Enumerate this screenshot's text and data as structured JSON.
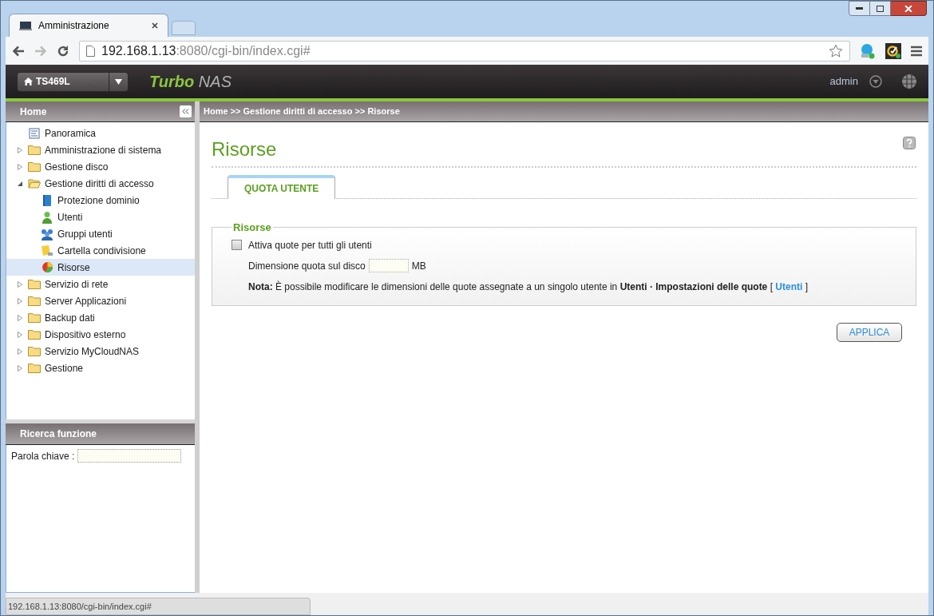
{
  "browser": {
    "tabs": [
      {
        "title": "Amministrazione",
        "selected": true
      }
    ],
    "address": {
      "host": "192.168.1.13",
      "rest": ":8080/cgi-bin/index.cgi#"
    }
  },
  "nas_header": {
    "device": "TS469L",
    "brand_bold": "Turbo",
    "brand_light": "NAS",
    "user": "admin"
  },
  "sidebar": {
    "title": "Home",
    "tree": [
      {
        "label": "Panoramica",
        "kind": "page",
        "selected": false
      },
      {
        "label": "Amministrazione di sistema",
        "kind": "folder",
        "expanded": false,
        "selected": false
      },
      {
        "label": "Gestione disco",
        "kind": "folder",
        "expanded": false,
        "selected": false
      },
      {
        "label": "Gestione diritti di accesso",
        "kind": "folder",
        "expanded": true,
        "selected": false,
        "children": [
          {
            "label": "Protezione dominio",
            "kind": "book",
            "selected": false
          },
          {
            "label": "Utenti",
            "kind": "user",
            "selected": false
          },
          {
            "label": "Gruppi utenti",
            "kind": "group",
            "selected": false
          },
          {
            "label": "Cartella condivisione",
            "kind": "share",
            "selected": false
          },
          {
            "label": "Risorse",
            "kind": "quota",
            "selected": true
          }
        ]
      },
      {
        "label": "Servizio di rete",
        "kind": "folder",
        "expanded": false,
        "selected": false
      },
      {
        "label": "Server Applicazioni",
        "kind": "folder",
        "expanded": false,
        "selected": false
      },
      {
        "label": "Backup dati",
        "kind": "folder",
        "expanded": false,
        "selected": false
      },
      {
        "label": "Dispositivo esterno",
        "kind": "folder",
        "expanded": false,
        "selected": false
      },
      {
        "label": "Servizio MyCloudNAS",
        "kind": "folder",
        "expanded": false,
        "selected": false
      },
      {
        "label": "Gestione",
        "kind": "folder",
        "expanded": false,
        "selected": false
      }
    ]
  },
  "search": {
    "title": "Ricerca funzione",
    "label": "Parola chiave :"
  },
  "breadcrumb": "Home >> Gestione diritti di accesso >> Risorse",
  "page": {
    "title": "Risorse",
    "tabs": [
      {
        "label": "QUOTA UTENTE",
        "selected": true
      }
    ],
    "section": {
      "legend": "Risorse",
      "checkbox": {
        "label": "Attiva quote per tutti gli utenti",
        "checked": false
      },
      "size_label": "Dimensione quota sul disco",
      "size_unit": "MB",
      "note": "**Nota:** È possibile modificare le dimensioni delle quote assegnate a un singolo utente in **Utenti · Impostazioni delle quote** [",
      "note_link": "Utenti",
      "note_end": "]"
    },
    "apply": "APPLICA"
  },
  "status_bar": "192.168.1.13:8080/cgi-bin/index.cgi#"
}
